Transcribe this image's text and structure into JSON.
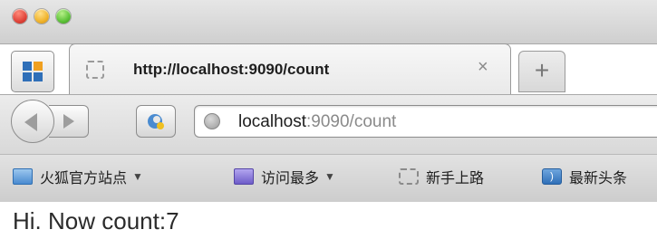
{
  "tab": {
    "title": "http://localhost:9090/count",
    "close_symbol": "×"
  },
  "new_tab": {
    "symbol": "+"
  },
  "urlbar": {
    "host": "localhost",
    "path": ":9090/count"
  },
  "bookmarks": [
    {
      "label": "火狐官方站点",
      "icon": "folder-icon",
      "has_menu": true
    },
    {
      "label": "访问最多",
      "icon": "smart-folder-icon",
      "has_menu": true
    },
    {
      "label": "新手上路",
      "icon": "page-icon",
      "has_menu": false
    },
    {
      "label": "最新头条",
      "icon": "rss-icon",
      "has_menu": false
    }
  ],
  "page": {
    "text": "Hi. Now count:7"
  }
}
